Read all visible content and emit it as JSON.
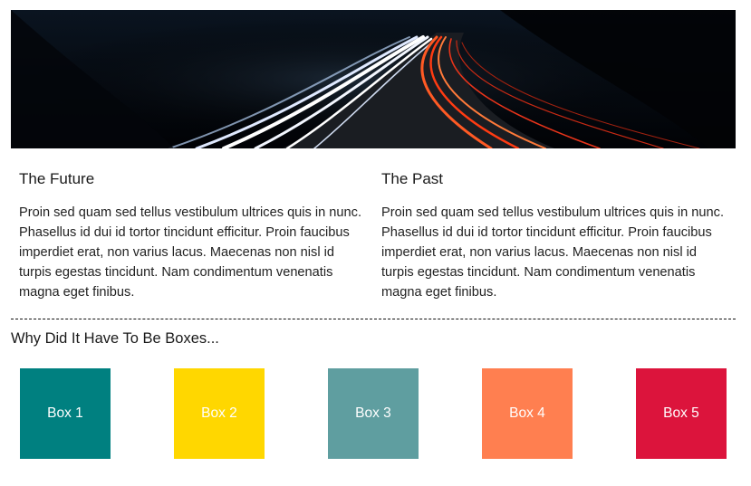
{
  "columns": [
    {
      "title": "The Future",
      "body": "Proin sed quam sed tellus vestibulum ultrices quis in nunc. Phasellus id dui id tortor tincidunt efficitur. Proin faucibus imperdiet erat, non varius lacus. Maecenas non nisl id turpis egestas tincidunt. Nam condimentum venenatis magna eget finibus."
    },
    {
      "title": "The Past",
      "body": "Proin sed quam sed tellus vestibulum ultrices quis in nunc. Phasellus id dui id tortor tincidunt efficitur. Proin faucibus imperdiet erat, non varius lacus. Maecenas non nisl id turpis egestas tincidunt. Nam condimentum venenatis magna eget finibus."
    }
  ],
  "boxes_section": {
    "heading": "Why Did It Have To Be Boxes...",
    "boxes": [
      {
        "label": "Box 1",
        "color": "#008080"
      },
      {
        "label": "Box 2",
        "color": "#FFD700"
      },
      {
        "label": "Box 3",
        "color": "#5F9EA0"
      },
      {
        "label": "Box 4",
        "color": "#FF7F50"
      },
      {
        "label": "Box 5",
        "color": "#DC143C"
      }
    ]
  },
  "hero": {
    "background_color": "#020409",
    "light_trail_colors": [
      "#ffffff",
      "#cfe0ff",
      "#ff4a1c",
      "#ff7a3a"
    ]
  }
}
